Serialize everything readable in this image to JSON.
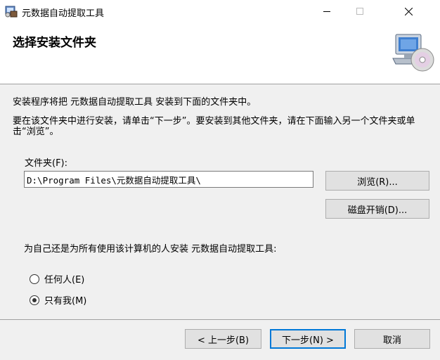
{
  "window": {
    "title": "元数据自动提取工具"
  },
  "header": {
    "title": "选择安装文件夹"
  },
  "body": {
    "line1": "安装程序将把 元数据自动提取工具 安装到下面的文件夹中。",
    "line2": "要在该文件夹中进行安装，请单击“下一步”。要安装到其他文件夹，请在下面输入另一个文件夹或单击“浏览”。"
  },
  "folder": {
    "label": "文件夹(F):",
    "value": "D:\\Program Files\\元数据自动提取工具\\"
  },
  "buttons": {
    "browse": "浏览(R)...",
    "disk_cost": "磁盘开销(D)...",
    "back": "< 上一步(B)",
    "next": "下一步(N) >",
    "cancel": "取消"
  },
  "install_for": {
    "question": "为自己还是为所有使用该计算机的人安装 元数据自动提取工具:",
    "options": [
      {
        "label": "任何人(E)",
        "selected": false
      },
      {
        "label": "只有我(M)",
        "selected": true
      }
    ]
  }
}
